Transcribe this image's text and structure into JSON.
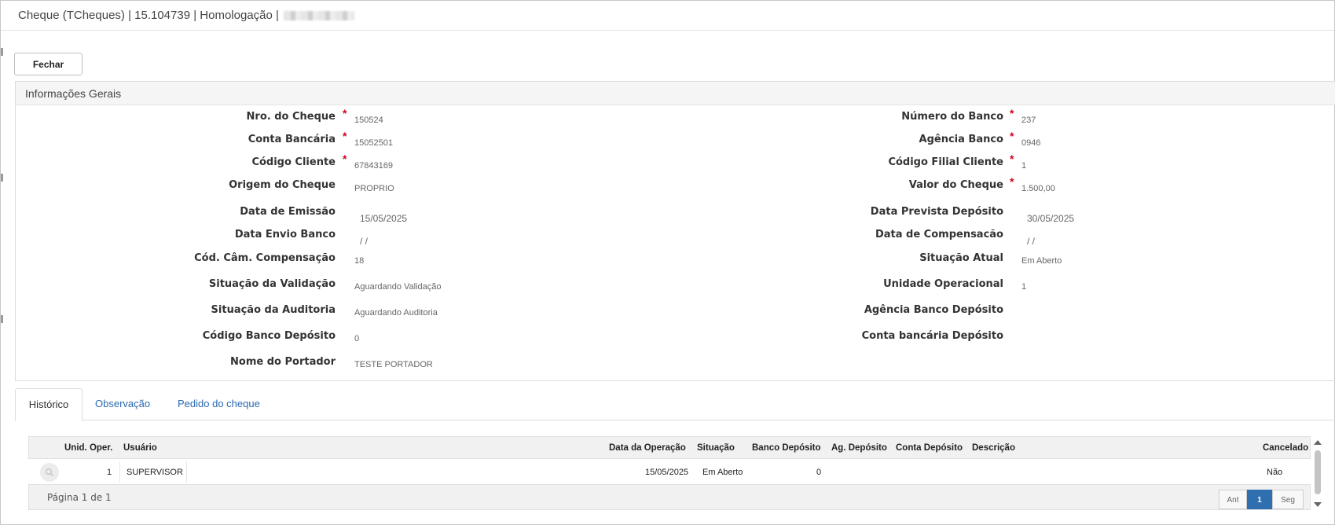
{
  "window": {
    "title": "Cheque (TCheques) | 15.104739 | Homologação |"
  },
  "toolbar": {
    "close_label": "Fechar"
  },
  "general": {
    "title": "Informações Gerais",
    "left": [
      {
        "label": "Nro. do Cheque",
        "value": "150524",
        "required": true
      },
      {
        "label": "Conta Bancária",
        "value": "15052501",
        "required": true
      },
      {
        "label": "Código Cliente",
        "value": "67843169",
        "required": true
      },
      {
        "label": "Origem do Cheque",
        "value": "PROPRIO",
        "required": false
      },
      {
        "label": "Data de Emissão",
        "value": "15/05/2025",
        "required": false
      },
      {
        "label": "Data Envio Banco",
        "value": "/ /",
        "required": false
      },
      {
        "label": "Cód. Câm. Compensação",
        "value": "18",
        "required": false
      },
      {
        "label": "Situação da Validação",
        "value": "Aguardando Validação",
        "required": false
      },
      {
        "label": "Situação da Auditoria",
        "value": "Aguardando Auditoria",
        "required": false
      },
      {
        "label": "Código Banco Depósito",
        "value": "0",
        "required": false
      },
      {
        "label": "Nome do Portador",
        "value": "TESTE PORTADOR",
        "required": false
      }
    ],
    "right": [
      {
        "label": "Número do Banco",
        "value": "237",
        "required": true
      },
      {
        "label": "Agência Banco",
        "value": "0946",
        "required": true
      },
      {
        "label": "Código Filial Cliente",
        "value": "1",
        "required": true
      },
      {
        "label": "Valor do Cheque",
        "value": "1.500,00",
        "required": true
      },
      {
        "label": "Data Prevista Depósito",
        "value": "30/05/2025",
        "required": false
      },
      {
        "label": "Data de Compensacão",
        "value": "/ /",
        "required": false
      },
      {
        "label": "Situação Atual",
        "value": "Em Aberto",
        "required": false
      },
      {
        "label": "Unidade Operacional",
        "value": "1",
        "required": false
      },
      {
        "label": "Agência Banco Depósito",
        "value": "",
        "required": false
      },
      {
        "label": "Conta bancária Depósito",
        "value": "",
        "required": false
      }
    ]
  },
  "tabs": [
    {
      "label": "Histórico",
      "active": true
    },
    {
      "label": "Observação",
      "active": false
    },
    {
      "label": "Pedido do cheque",
      "active": false
    }
  ],
  "grid": {
    "columns": [
      "Unid. Oper.",
      "Usuário",
      "Data da Operação",
      "Situação",
      "Banco Depósito",
      "Ag. Depósito",
      "Conta Depósito",
      "Descrição",
      "Cancelado"
    ],
    "rows": [
      {
        "unid": "1",
        "usuario": "SUPERVISOR",
        "data": "15/05/2025",
        "situacao": "Em Aberto",
        "banco": "0",
        "agencia": "",
        "conta": "",
        "descricao": "",
        "cancelado": "Não"
      }
    ],
    "pagination": {
      "label": "Página 1 de 1",
      "prev": "Ant",
      "current": "1",
      "next": "Seg"
    }
  },
  "icons": {
    "row_action": "magnifier-icon"
  },
  "colors": {
    "required": "#d0021b",
    "link": "#2a6ab0",
    "page_active": "#2f6fb0"
  }
}
